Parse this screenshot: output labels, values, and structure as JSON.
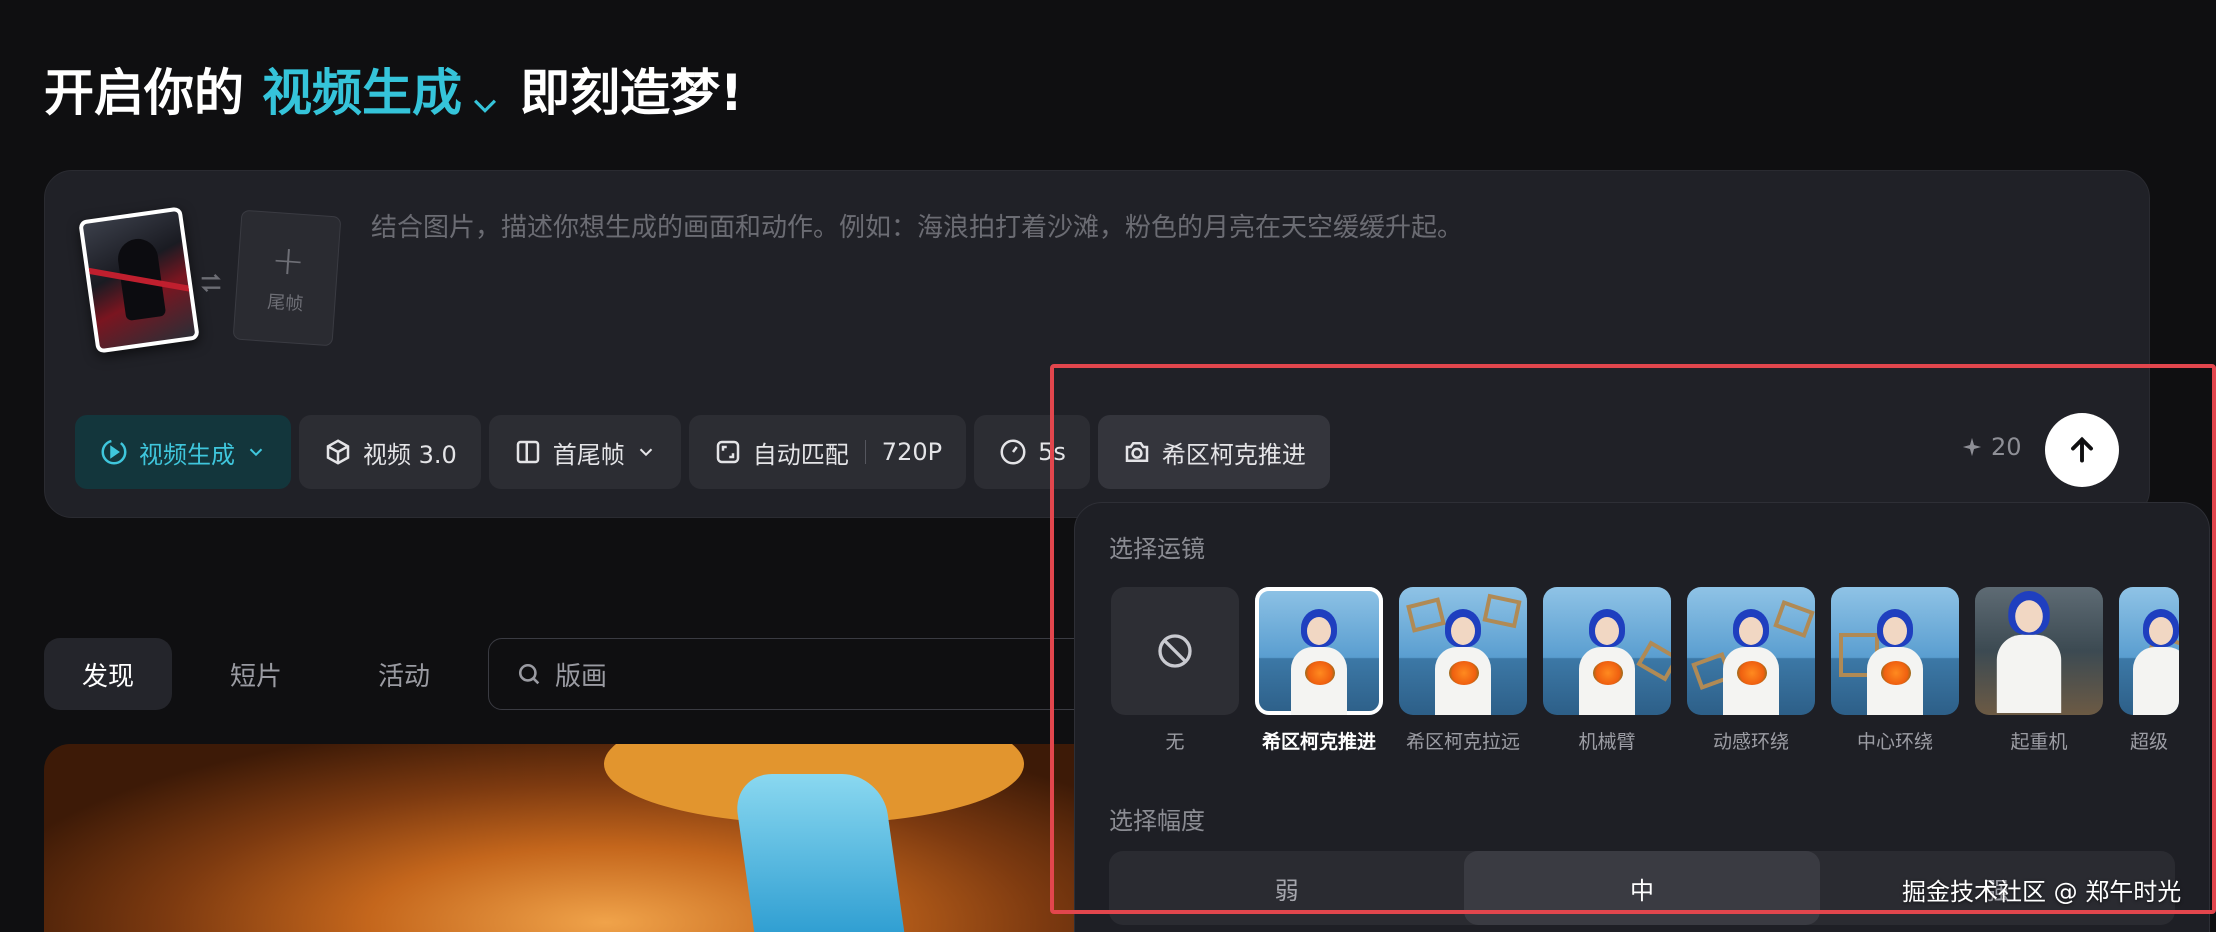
{
  "headline": {
    "prefix": "开启你的",
    "mode": "视频生成",
    "suffix": "即刻造梦!"
  },
  "composer": {
    "end_frame_label": "尾帧",
    "prompt_placeholder": "结合图片，描述你想生成的画面和动作。例如：海浪拍打着沙滩，粉色的月亮在天空缓缓升起。",
    "tools": {
      "mode": "视频生成",
      "model": "视频 3.0",
      "frames": "首尾帧",
      "ratio": "自动匹配",
      "resolution": "720P",
      "duration": "5s",
      "camera": "希区柯克推进"
    },
    "credits": "20"
  },
  "tabs": [
    "发现",
    "短片",
    "活动"
  ],
  "search": {
    "value": "版画"
  },
  "camera_panel": {
    "title": "选择运镜",
    "options": [
      {
        "label": "无",
        "icon": "ban-icon"
      },
      {
        "label": "希区柯克推进",
        "selected": true
      },
      {
        "label": "希区柯克拉远"
      },
      {
        "label": "机械臂"
      },
      {
        "label": "动感环绕"
      },
      {
        "label": "中心环绕"
      },
      {
        "label": "起重机"
      },
      {
        "label": "超级"
      }
    ],
    "amplitude_title": "选择幅度",
    "amplitude": [
      "弱",
      "中",
      "强"
    ],
    "amplitude_selected": "中"
  },
  "watermark": "掘金技术社区 @ 郑午时光",
  "colors": {
    "accent": "#35c4da",
    "highlight_box": "#e2464d",
    "background": "#0f0f11"
  }
}
